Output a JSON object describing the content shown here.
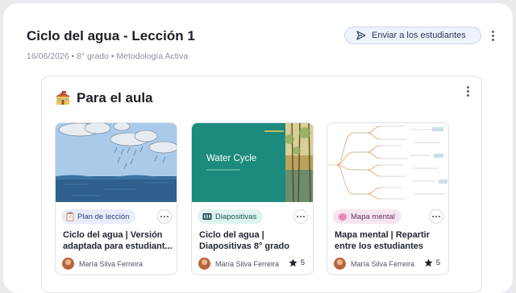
{
  "header": {
    "title": "Ciclo del agua - Lección 1",
    "meta": "16/06/2026 • 8° grado • Metodología Activa",
    "send_button": "Enviar a los estudiantes"
  },
  "section": {
    "title": "Para el aula",
    "icon": "school-icon"
  },
  "cards": [
    {
      "badge": "Plan de lección",
      "badge_icon": "clipboard-icon",
      "title_line1": "Ciclo del agua | Versión",
      "title_line2": "adaptada para estudiant...",
      "author": "María Silva Ferreira",
      "rating": ""
    },
    {
      "badge": "Diapositivas",
      "badge_icon": "slides-icon",
      "thumb_title": "Water Cycle",
      "title_line1": "Ciclo del agua |",
      "title_line2": "Diapositivas 8° grado",
      "author": "María Silva Ferreira",
      "rating": "5"
    },
    {
      "badge": "Mapa mental",
      "badge_icon": "brain-icon",
      "title_line1": "Mapa mental | Repartir",
      "title_line2": "entre los estudiantes",
      "author": "María Silva Ferreira",
      "rating": "5"
    }
  ],
  "colors": {
    "accent_blue": "#2d3a5c",
    "lesson_badge_bg": "#e8ecfb",
    "slides_badge_bg": "#dff4f0",
    "mindmap_badge_bg": "#f6e6f2",
    "slide_green": "#1c8a7c"
  }
}
